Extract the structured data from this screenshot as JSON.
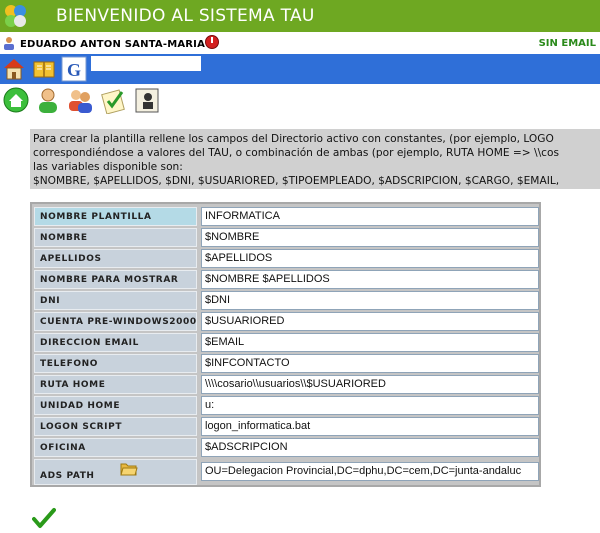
{
  "header": {
    "title": "BIENVENIDO AL SISTEMA TAU"
  },
  "user_bar": {
    "user_name": "EDUARDO ANTON SANTA-MARIA",
    "mail_status": "SIN EMAIL"
  },
  "toolbar": {
    "search_value": "",
    "icons": [
      "home-icon",
      "book-icon",
      "google-icon"
    ]
  },
  "nav_icons": [
    "home-circle-icon",
    "user-icon",
    "users-icon",
    "checklist-icon",
    "id-card-icon"
  ],
  "info": {
    "line1": "Para crear la plantilla rellene los campos del Directorio activo con constantes, (por ejemplo, LOGO",
    "line2": "correspondiéndose a valores del TAU, o combinación de ambas (por ejemplo, RUTA HOME => \\\\cos",
    "line3": "las variables disponible son:",
    "line4": "$NOMBRE, $APELLIDOS, $DNI, $USUARIORED, $TIPOEMPLEADO, $ADSCRIPCION, $CARGO, $EMAIL,"
  },
  "form": {
    "fields": [
      {
        "label": "NOMBRE PLANTILLA",
        "value": "INFORMATICA"
      },
      {
        "label": "NOMBRE",
        "value": "$NOMBRE"
      },
      {
        "label": "APELLIDOS",
        "value": "$APELLIDOS"
      },
      {
        "label": "NOMBRE PARA MOSTRAR",
        "value": "$NOMBRE $APELLIDOS"
      },
      {
        "label": "DNI",
        "value": "$DNI"
      },
      {
        "label": "CUENTA PRE-WINDOWS2000",
        "value": "$USUARIORED"
      },
      {
        "label": "DIRECCION EMAIL",
        "value": "$EMAIL"
      },
      {
        "label": "TELEFONO",
        "value": "$INFCONTACTO"
      },
      {
        "label": "RUTA HOME",
        "value": "\\\\\\\\cosario\\\\usuarios\\\\$USUARIORED"
      },
      {
        "label": "UNIDAD HOME",
        "value": "u:"
      },
      {
        "label": "LOGON SCRIPT",
        "value": "logon_informatica.bat"
      },
      {
        "label": "OFICINA",
        "value": "$ADSCRIPCION"
      },
      {
        "label": "ADS PATH",
        "value": "OU=Delegacion Provincial,DC=dphu,DC=cem,DC=junta-andaluc"
      }
    ]
  },
  "colors": {
    "header_green": "#6ea822",
    "toolbar_blue": "#2f6fd8",
    "info_gray": "#d0d0d0",
    "label_blue": "#c8d2dc",
    "label_highlight": "#b4dae6"
  }
}
